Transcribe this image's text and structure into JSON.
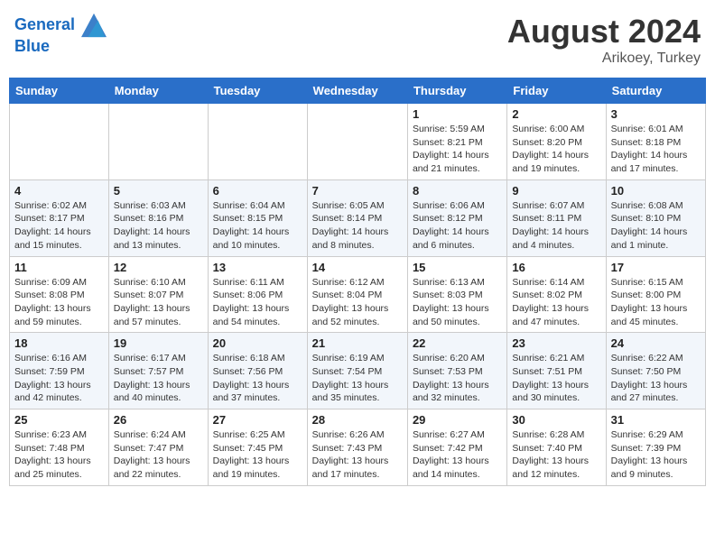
{
  "header": {
    "logo_line1": "General",
    "logo_line2": "Blue",
    "month_year": "August 2024",
    "location": "Arikoey, Turkey"
  },
  "weekdays": [
    "Sunday",
    "Monday",
    "Tuesday",
    "Wednesday",
    "Thursday",
    "Friday",
    "Saturday"
  ],
  "weeks": [
    [
      {
        "day": "",
        "sunrise": "",
        "sunset": "",
        "daylight": ""
      },
      {
        "day": "",
        "sunrise": "",
        "sunset": "",
        "daylight": ""
      },
      {
        "day": "",
        "sunrise": "",
        "sunset": "",
        "daylight": ""
      },
      {
        "day": "",
        "sunrise": "",
        "sunset": "",
        "daylight": ""
      },
      {
        "day": "1",
        "sunrise": "5:59 AM",
        "sunset": "8:21 PM",
        "daylight": "14 hours and 21 minutes."
      },
      {
        "day": "2",
        "sunrise": "6:00 AM",
        "sunset": "8:20 PM",
        "daylight": "14 hours and 19 minutes."
      },
      {
        "day": "3",
        "sunrise": "6:01 AM",
        "sunset": "8:18 PM",
        "daylight": "14 hours and 17 minutes."
      }
    ],
    [
      {
        "day": "4",
        "sunrise": "6:02 AM",
        "sunset": "8:17 PM",
        "daylight": "14 hours and 15 minutes."
      },
      {
        "day": "5",
        "sunrise": "6:03 AM",
        "sunset": "8:16 PM",
        "daylight": "14 hours and 13 minutes."
      },
      {
        "day": "6",
        "sunrise": "6:04 AM",
        "sunset": "8:15 PM",
        "daylight": "14 hours and 10 minutes."
      },
      {
        "day": "7",
        "sunrise": "6:05 AM",
        "sunset": "8:14 PM",
        "daylight": "14 hours and 8 minutes."
      },
      {
        "day": "8",
        "sunrise": "6:06 AM",
        "sunset": "8:12 PM",
        "daylight": "14 hours and 6 minutes."
      },
      {
        "day": "9",
        "sunrise": "6:07 AM",
        "sunset": "8:11 PM",
        "daylight": "14 hours and 4 minutes."
      },
      {
        "day": "10",
        "sunrise": "6:08 AM",
        "sunset": "8:10 PM",
        "daylight": "14 hours and 1 minute."
      }
    ],
    [
      {
        "day": "11",
        "sunrise": "6:09 AM",
        "sunset": "8:08 PM",
        "daylight": "13 hours and 59 minutes."
      },
      {
        "day": "12",
        "sunrise": "6:10 AM",
        "sunset": "8:07 PM",
        "daylight": "13 hours and 57 minutes."
      },
      {
        "day": "13",
        "sunrise": "6:11 AM",
        "sunset": "8:06 PM",
        "daylight": "13 hours and 54 minutes."
      },
      {
        "day": "14",
        "sunrise": "6:12 AM",
        "sunset": "8:04 PM",
        "daylight": "13 hours and 52 minutes."
      },
      {
        "day": "15",
        "sunrise": "6:13 AM",
        "sunset": "8:03 PM",
        "daylight": "13 hours and 50 minutes."
      },
      {
        "day": "16",
        "sunrise": "6:14 AM",
        "sunset": "8:02 PM",
        "daylight": "13 hours and 47 minutes."
      },
      {
        "day": "17",
        "sunrise": "6:15 AM",
        "sunset": "8:00 PM",
        "daylight": "13 hours and 45 minutes."
      }
    ],
    [
      {
        "day": "18",
        "sunrise": "6:16 AM",
        "sunset": "7:59 PM",
        "daylight": "13 hours and 42 minutes."
      },
      {
        "day": "19",
        "sunrise": "6:17 AM",
        "sunset": "7:57 PM",
        "daylight": "13 hours and 40 minutes."
      },
      {
        "day": "20",
        "sunrise": "6:18 AM",
        "sunset": "7:56 PM",
        "daylight": "13 hours and 37 minutes."
      },
      {
        "day": "21",
        "sunrise": "6:19 AM",
        "sunset": "7:54 PM",
        "daylight": "13 hours and 35 minutes."
      },
      {
        "day": "22",
        "sunrise": "6:20 AM",
        "sunset": "7:53 PM",
        "daylight": "13 hours and 32 minutes."
      },
      {
        "day": "23",
        "sunrise": "6:21 AM",
        "sunset": "7:51 PM",
        "daylight": "13 hours and 30 minutes."
      },
      {
        "day": "24",
        "sunrise": "6:22 AM",
        "sunset": "7:50 PM",
        "daylight": "13 hours and 27 minutes."
      }
    ],
    [
      {
        "day": "25",
        "sunrise": "6:23 AM",
        "sunset": "7:48 PM",
        "daylight": "13 hours and 25 minutes."
      },
      {
        "day": "26",
        "sunrise": "6:24 AM",
        "sunset": "7:47 PM",
        "daylight": "13 hours and 22 minutes."
      },
      {
        "day": "27",
        "sunrise": "6:25 AM",
        "sunset": "7:45 PM",
        "daylight": "13 hours and 19 minutes."
      },
      {
        "day": "28",
        "sunrise": "6:26 AM",
        "sunset": "7:43 PM",
        "daylight": "13 hours and 17 minutes."
      },
      {
        "day": "29",
        "sunrise": "6:27 AM",
        "sunset": "7:42 PM",
        "daylight": "13 hours and 14 minutes."
      },
      {
        "day": "30",
        "sunrise": "6:28 AM",
        "sunset": "7:40 PM",
        "daylight": "13 hours and 12 minutes."
      },
      {
        "day": "31",
        "sunrise": "6:29 AM",
        "sunset": "7:39 PM",
        "daylight": "13 hours and 9 minutes."
      }
    ]
  ],
  "labels": {
    "sunrise": "Sunrise:",
    "sunset": "Sunset:",
    "daylight": "Daylight:"
  }
}
